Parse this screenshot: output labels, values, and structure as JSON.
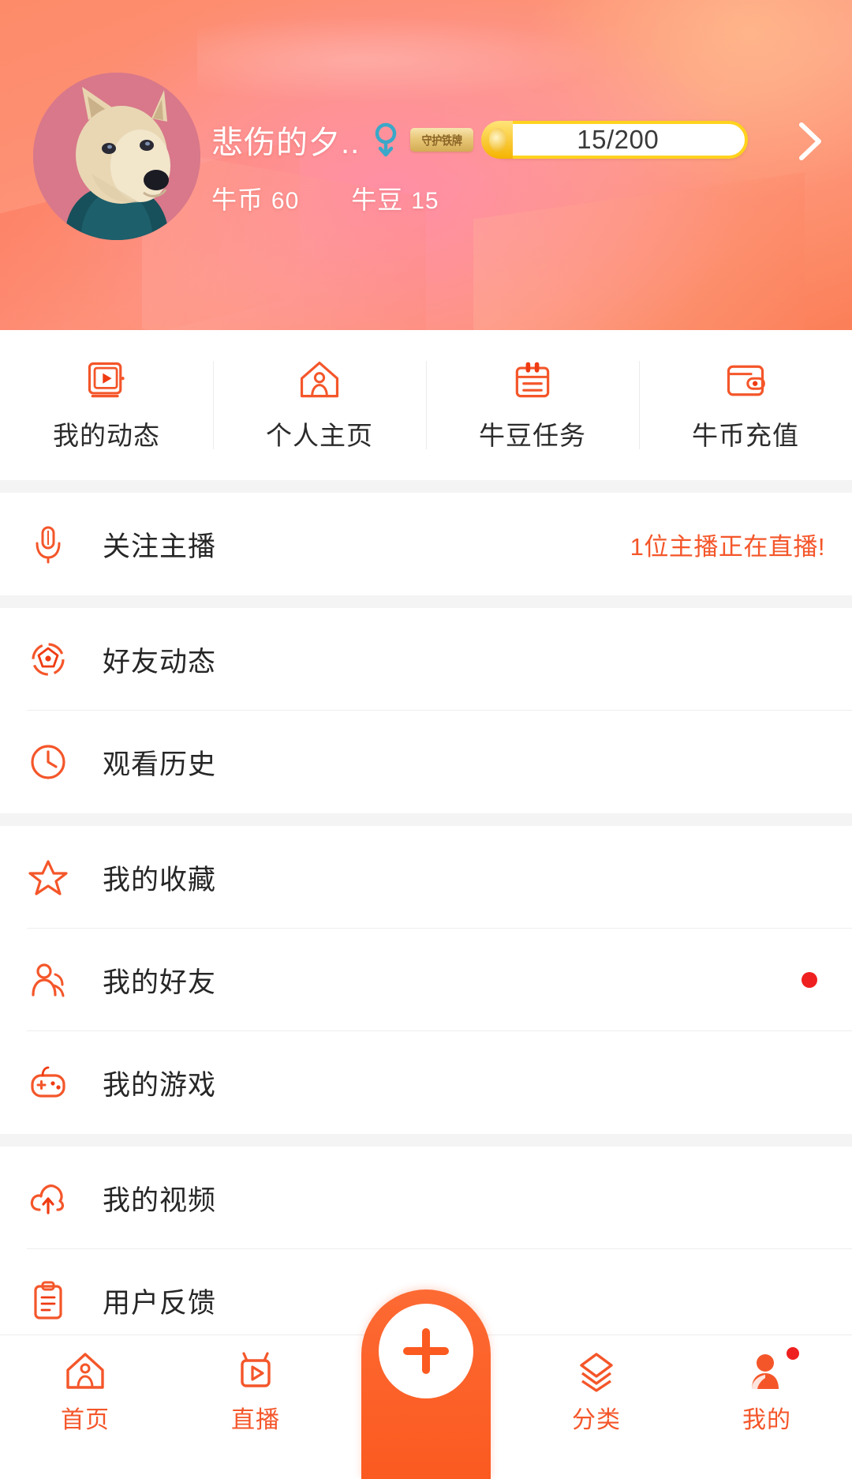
{
  "header": {
    "username": "悲伤的夕..",
    "gender_icon": "female-gender-icon",
    "vip_badge_label": "守护铁牌",
    "level_progress": "15/200",
    "chevron_icon": "chevron-right-icon",
    "coins": [
      {
        "label": "牛币",
        "value": "60"
      },
      {
        "label": "牛豆",
        "value": "15"
      }
    ]
  },
  "quick_actions": [
    {
      "label": "我的动态",
      "icon": "video-feed-icon"
    },
    {
      "label": "个人主页",
      "icon": "home-person-icon"
    },
    {
      "label": "牛豆任务",
      "icon": "task-list-icon"
    },
    {
      "label": "牛币充值",
      "icon": "wallet-icon"
    }
  ],
  "menu_groups": [
    {
      "items": [
        {
          "label": "关注主播",
          "icon": "microphone-icon",
          "right_text": "1位主播正在直播!",
          "dot": false
        }
      ]
    },
    {
      "items": [
        {
          "label": "好友动态",
          "icon": "friends-feed-icon",
          "right_text": "",
          "dot": false
        },
        {
          "label": "观看历史",
          "icon": "clock-history-icon",
          "right_text": "",
          "dot": false
        }
      ]
    },
    {
      "items": [
        {
          "label": "我的收藏",
          "icon": "star-icon",
          "right_text": "",
          "dot": false
        },
        {
          "label": "我的好友",
          "icon": "user-friends-icon",
          "right_text": "",
          "dot": true
        },
        {
          "label": "我的游戏",
          "icon": "gamepad-icon",
          "right_text": "",
          "dot": false
        }
      ]
    },
    {
      "items": [
        {
          "label": "我的视频",
          "icon": "cloud-upload-icon",
          "right_text": "",
          "dot": false
        },
        {
          "label": "用户反馈",
          "icon": "clipboard-icon",
          "right_text": "",
          "dot": false
        }
      ]
    }
  ],
  "tabbar": {
    "items": [
      {
        "label": "首页",
        "icon": "home-icon",
        "active": true,
        "dot": false
      },
      {
        "label": "直播",
        "icon": "live-video-icon",
        "active": true,
        "dot": false
      },
      {
        "label": "分类",
        "icon": "layers-category-icon",
        "active": true,
        "dot": false
      },
      {
        "label": "我的",
        "icon": "profile-person-icon",
        "active": true,
        "dot": true
      }
    ],
    "fab_icon": "plus-icon"
  },
  "colors": {
    "accent": "#f4562a",
    "header_gradient_start": "#fd8b6a",
    "header_gradient_end": "#fb7f58",
    "badge_red": "#ef2020",
    "level_gold": "#ffd21e"
  }
}
